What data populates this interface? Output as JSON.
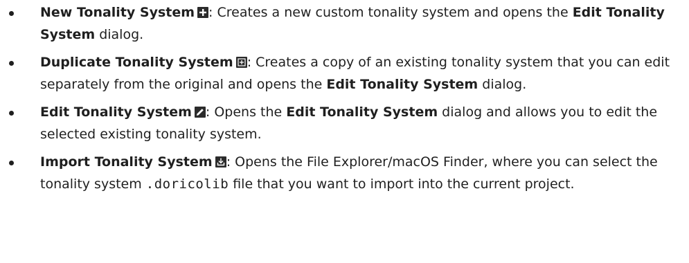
{
  "items": [
    {
      "term": "New Tonality System",
      "icon": "plus-icon",
      "text1": ": Creates a new custom tonality system and opens the ",
      "ref": "Edit Tonality System",
      "text2": " dialog."
    },
    {
      "term": "Duplicate Tonality System",
      "icon": "duplicate-icon",
      "text1": ": Creates a copy of an existing tonality system that you can edit separately from the original and opens the ",
      "ref": "Edit Tonality System",
      "text2": " dialog."
    },
    {
      "term": "Edit Tonality System",
      "icon": "pencil-icon",
      "text1": ": Opens the ",
      "ref": "Edit Tonality System",
      "text2": " dialog and allows you to edit the selected existing tonality system."
    },
    {
      "term": "Import Tonality System",
      "icon": "import-icon",
      "text1": ": Opens the File Explorer/macOS Finder, where you can select the tonality system ",
      "code": ".doricolib",
      "text2": " file that you want to import into the current project."
    }
  ]
}
